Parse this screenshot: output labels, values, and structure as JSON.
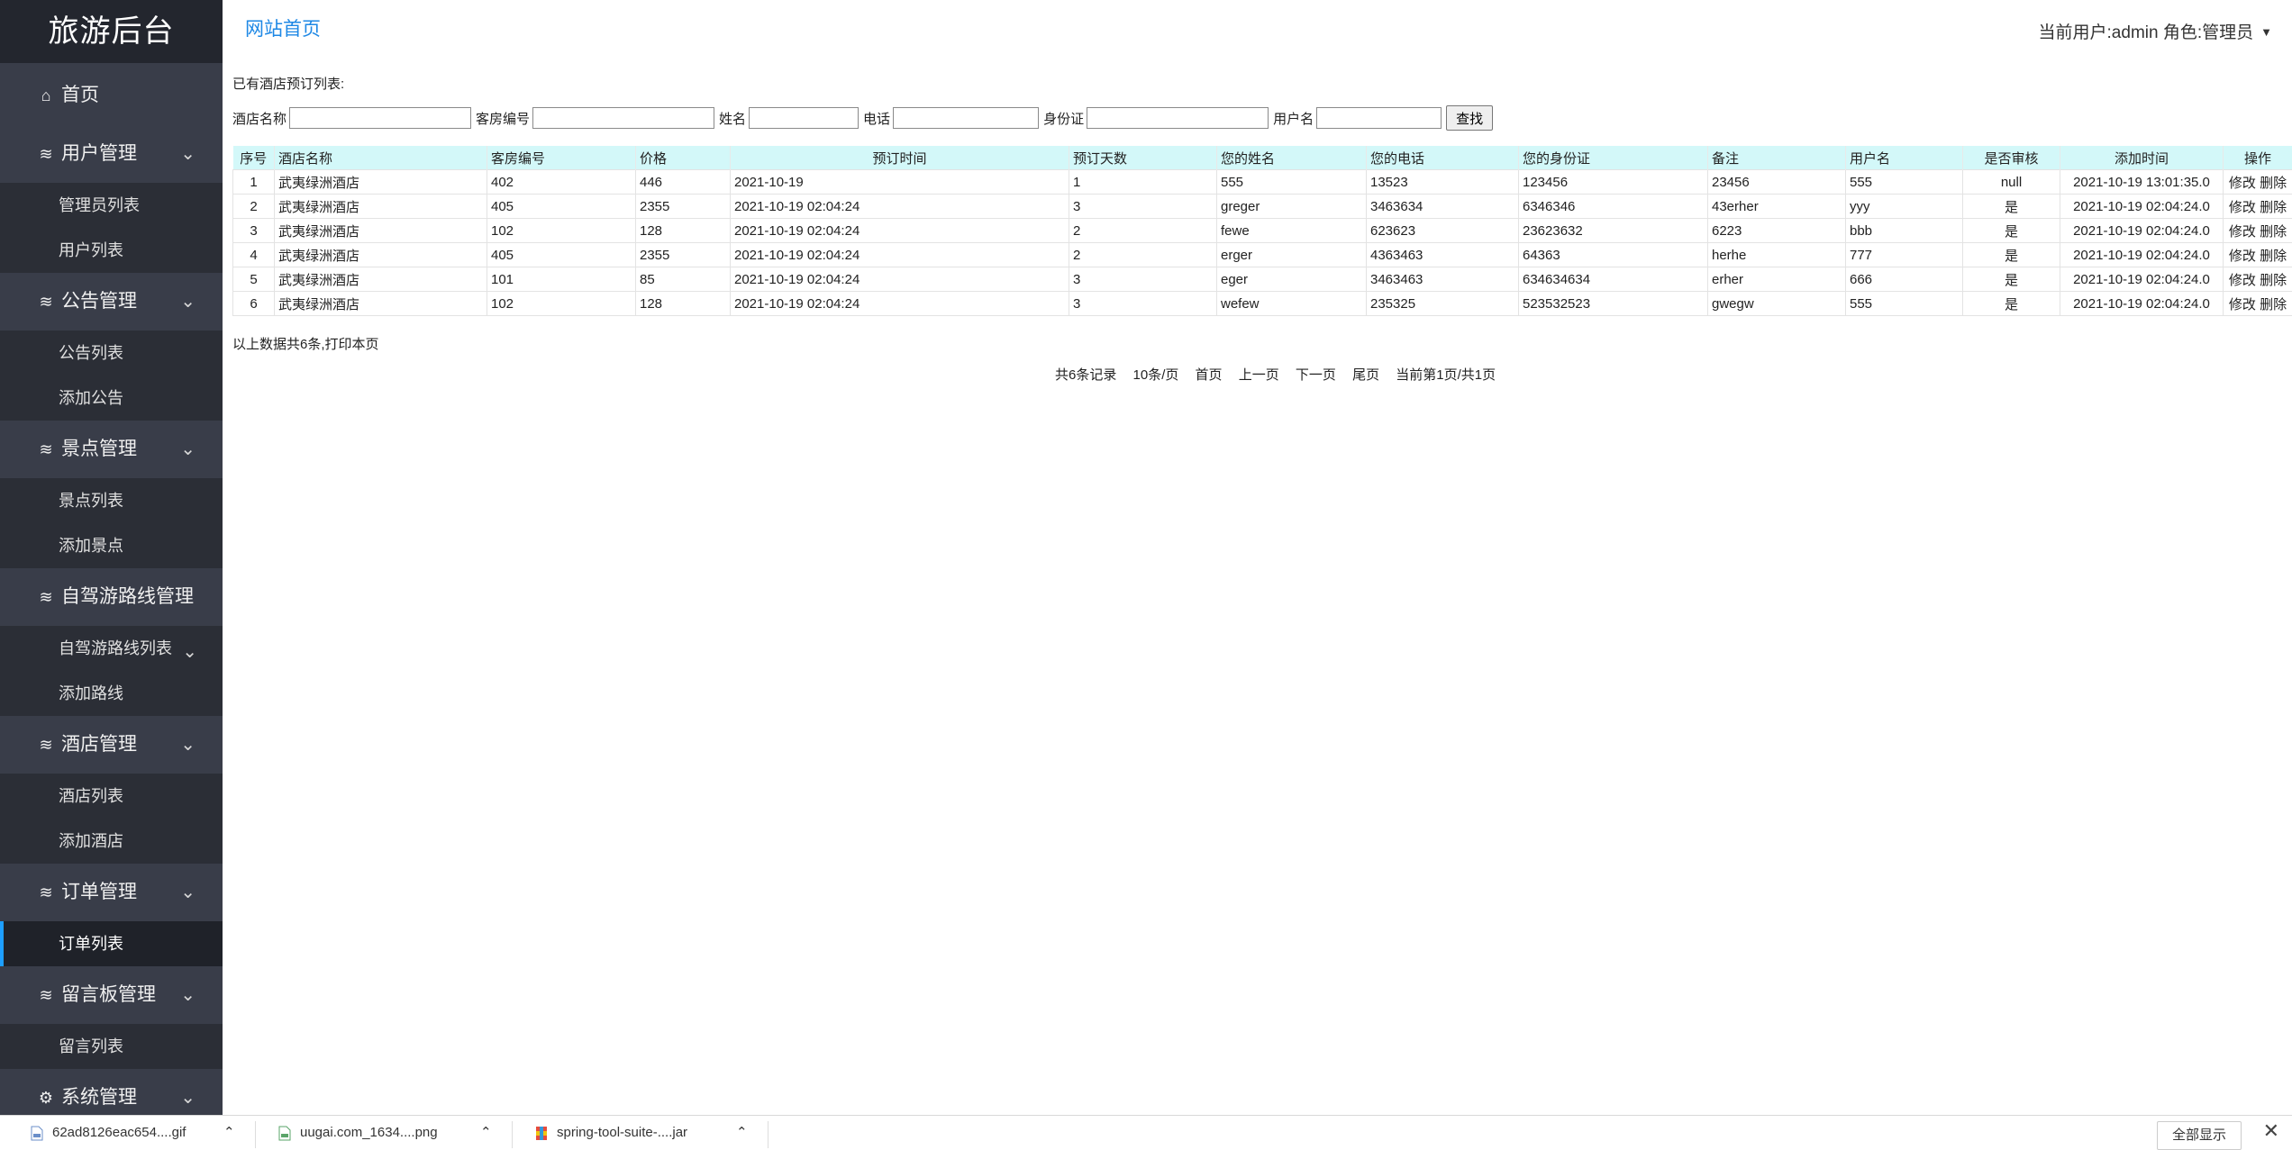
{
  "sidebar": {
    "brand": "旅游后台",
    "home": "首页",
    "groups": [
      {
        "label": "用户管理",
        "items": [
          "管理员列表",
          "用户列表"
        ]
      },
      {
        "label": "公告管理",
        "items": [
          "公告列表",
          "添加公告"
        ]
      },
      {
        "label": "景点管理",
        "items": [
          "景点列表",
          "添加景点"
        ]
      },
      {
        "label": "自驾游路线管理",
        "items": [
          "自驾游路线列表",
          "添加路线"
        ]
      },
      {
        "label": "酒店管理",
        "items": [
          "酒店列表",
          "添加酒店"
        ]
      },
      {
        "label": "订单管理",
        "items": [
          "订单列表"
        ]
      },
      {
        "label": "留言板管理",
        "items": [
          "留言列表"
        ]
      },
      {
        "label": "系统管理",
        "items": []
      }
    ]
  },
  "header": {
    "site_link": "网站首页",
    "user_info": "当前用户:admin  角色:管理员"
  },
  "main": {
    "list_title": "已有酒店预订列表:",
    "search": {
      "hotel_name": "酒店名称",
      "room_no": "客房编号",
      "name": "姓名",
      "phone": "电话",
      "id_card": "身份证",
      "username": "用户名",
      "button": "查找"
    },
    "columns": [
      "序号",
      "酒店名称",
      "客房编号",
      "价格",
      "预订时间",
      "预订天数",
      "您的姓名",
      "您的电话",
      "您的身份证",
      "备注",
      "用户名",
      "是否审核",
      "添加时间",
      "操作"
    ],
    "rows": [
      [
        "1",
        "武夷绿洲酒店",
        "402",
        "446",
        "2021-10-19",
        "1",
        "555",
        "13523",
        "123456",
        "23456",
        "555",
        "null",
        "2021-10-19 13:01:35.0"
      ],
      [
        "2",
        "武夷绿洲酒店",
        "405",
        "2355",
        "2021-10-19 02:04:24",
        "3",
        "greger",
        "3463634",
        "6346346",
        "43erher",
        "yyy",
        "是",
        "2021-10-19 02:04:24.0"
      ],
      [
        "3",
        "武夷绿洲酒店",
        "102",
        "128",
        "2021-10-19 02:04:24",
        "2",
        "fewe",
        "623623",
        "23623632",
        "6223",
        "bbb",
        "是",
        "2021-10-19 02:04:24.0"
      ],
      [
        "4",
        "武夷绿洲酒店",
        "405",
        "2355",
        "2021-10-19 02:04:24",
        "2",
        "erger",
        "4363463",
        "64363",
        "herhe",
        "777",
        "是",
        "2021-10-19 02:04:24.0"
      ],
      [
        "5",
        "武夷绿洲酒店",
        "101",
        "85",
        "2021-10-19 02:04:24",
        "3",
        "eger",
        "3463463",
        "634634634",
        "erher",
        "666",
        "是",
        "2021-10-19 02:04:24.0"
      ],
      [
        "6",
        "武夷绿洲酒店",
        "102",
        "128",
        "2021-10-19 02:04:24",
        "3",
        "wefew",
        "235325",
        "523532523",
        "gwegw",
        "555",
        "是",
        "2021-10-19 02:04:24.0"
      ]
    ],
    "row_actions": {
      "edit": "修改",
      "delete": "删除"
    },
    "summary": "以上数据共6条,打印本页",
    "pager": {
      "total": "共6条记录",
      "per_page": "10条/页",
      "first": "首页",
      "prev": "上一页",
      "next": "下一页",
      "last": "尾页",
      "current": "当前第1页/共1页"
    }
  },
  "downloads": {
    "items": [
      "62ad8126eac654....gif",
      "uugai.com_1634....png",
      "spring-tool-suite-....jar"
    ],
    "show_all": "全部显示"
  },
  "colors": {
    "sidebar_bg": "#393d49",
    "brand_bg": "#23262e",
    "table_header_bg": "#d3f8f9",
    "link": "#1e88e5",
    "active_marker": "#1e9fff"
  },
  "icons": {
    "home": "home-icon",
    "group": "layers-icon",
    "system": "gear-icon",
    "expand": "chevron-down-icon"
  }
}
